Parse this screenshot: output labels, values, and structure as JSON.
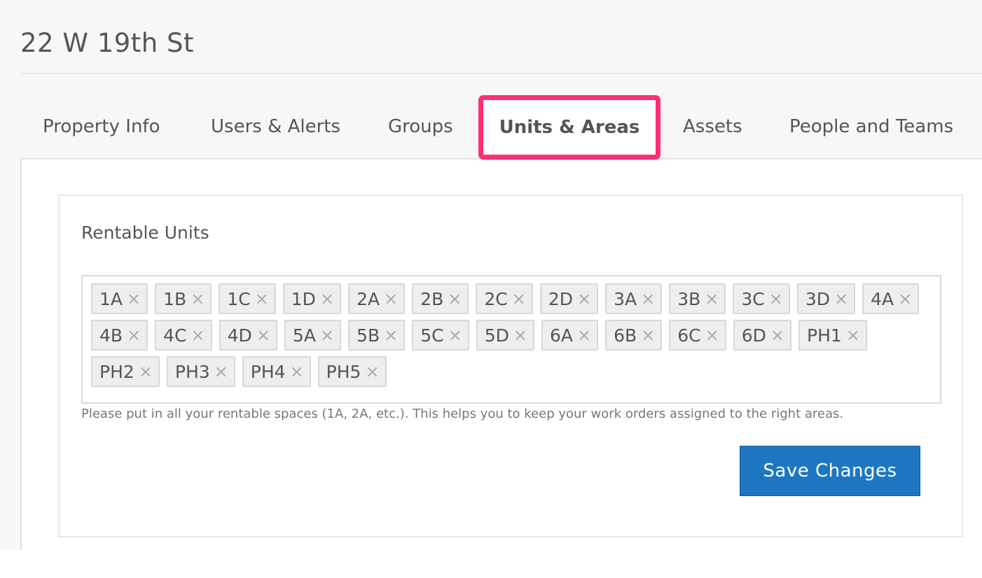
{
  "page": {
    "title": "22 W 19th St"
  },
  "tabs": [
    {
      "label": "Property Info"
    },
    {
      "label": "Users & Alerts"
    },
    {
      "label": "Groups"
    },
    {
      "label": "Units & Areas",
      "active": true
    },
    {
      "label": "Assets"
    },
    {
      "label": "People and Teams"
    }
  ],
  "units": {
    "title": "Rentable Units",
    "tags": [
      [
        "1A",
        "1B",
        "1C",
        "1D",
        "2A",
        "2B",
        "2C",
        "2D",
        "3A",
        "3B",
        "3C",
        "3D",
        "4A"
      ],
      [
        "4B",
        "4C",
        "4D",
        "5A",
        "5B",
        "5C",
        "5D",
        "6A",
        "6B",
        "6C",
        "6D",
        "PH1"
      ],
      [
        "PH2",
        "PH3",
        "PH4",
        "PH5"
      ]
    ],
    "remove_icon": "×",
    "help_text": "Please put in all your rentable spaces (1A, 2A, etc.). This helps you to keep your work orders assigned to the right areas.",
    "save_label": "Save Changes"
  },
  "colors": {
    "active_tab_highlight": "#ff2f72",
    "primary_button": "#1e76c1"
  }
}
